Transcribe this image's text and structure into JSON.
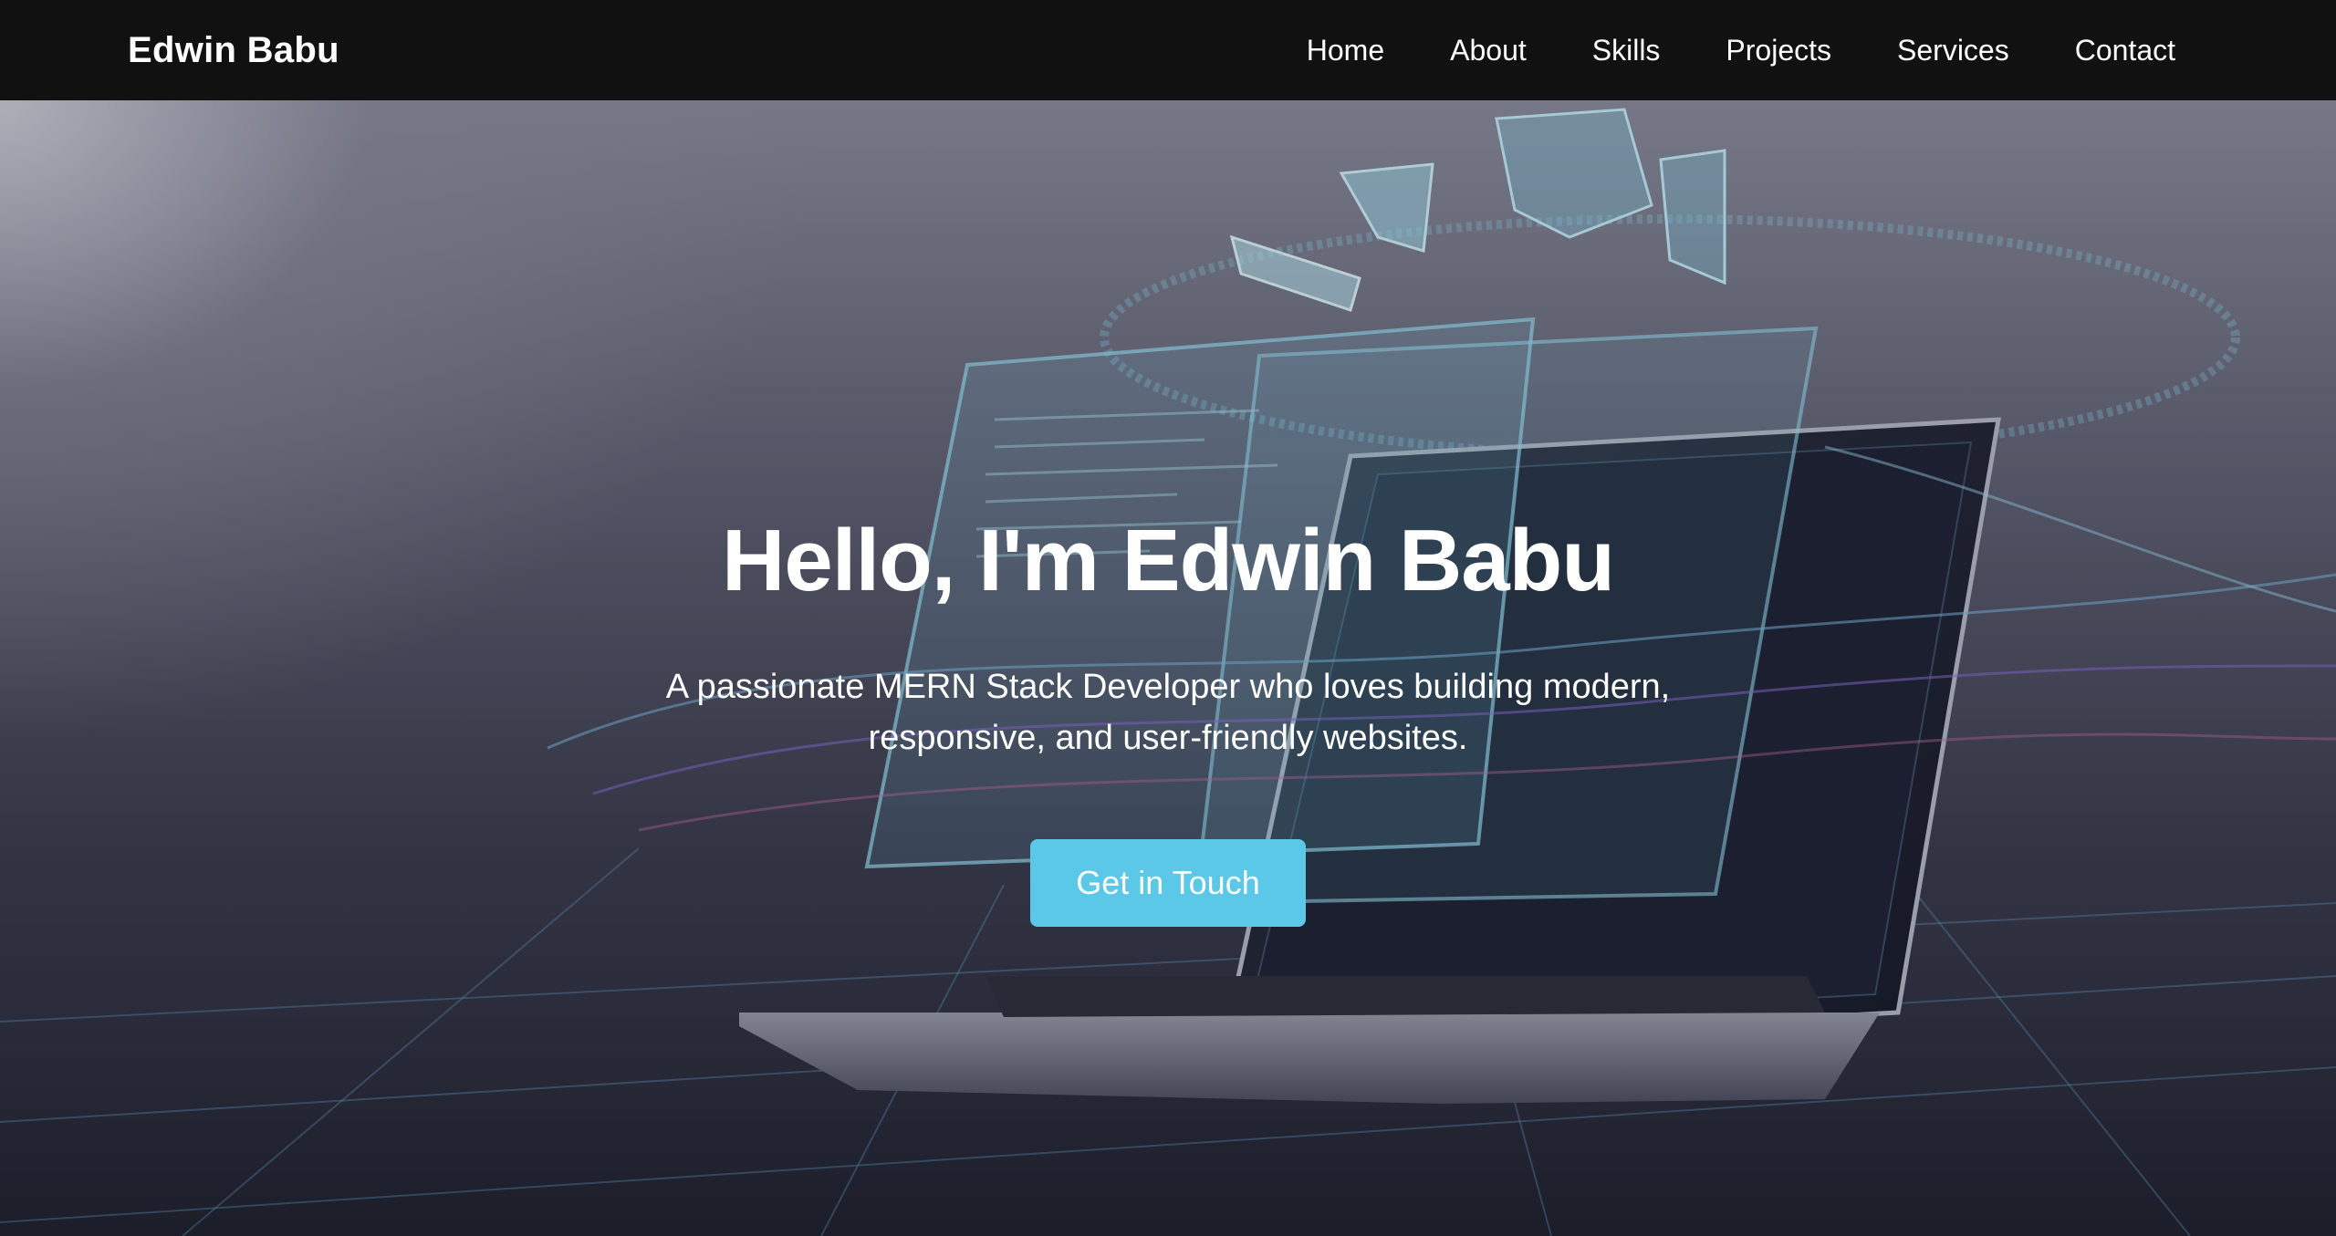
{
  "nav": {
    "brand": "Edwin Babu",
    "links": [
      "Home",
      "About",
      "Skills",
      "Projects",
      "Services",
      "Contact"
    ]
  },
  "hero": {
    "title": "Hello, I'm Edwin Babu",
    "subtitle": "A passionate MERN Stack Developer who loves building modern, responsive, and user-friendly websites.",
    "cta_label": "Get in Touch"
  },
  "colors": {
    "navbar": "#111111",
    "accent": "#5bc8e8",
    "text": "#ffffff"
  },
  "icons": [
    "laptop-illustration"
  ]
}
